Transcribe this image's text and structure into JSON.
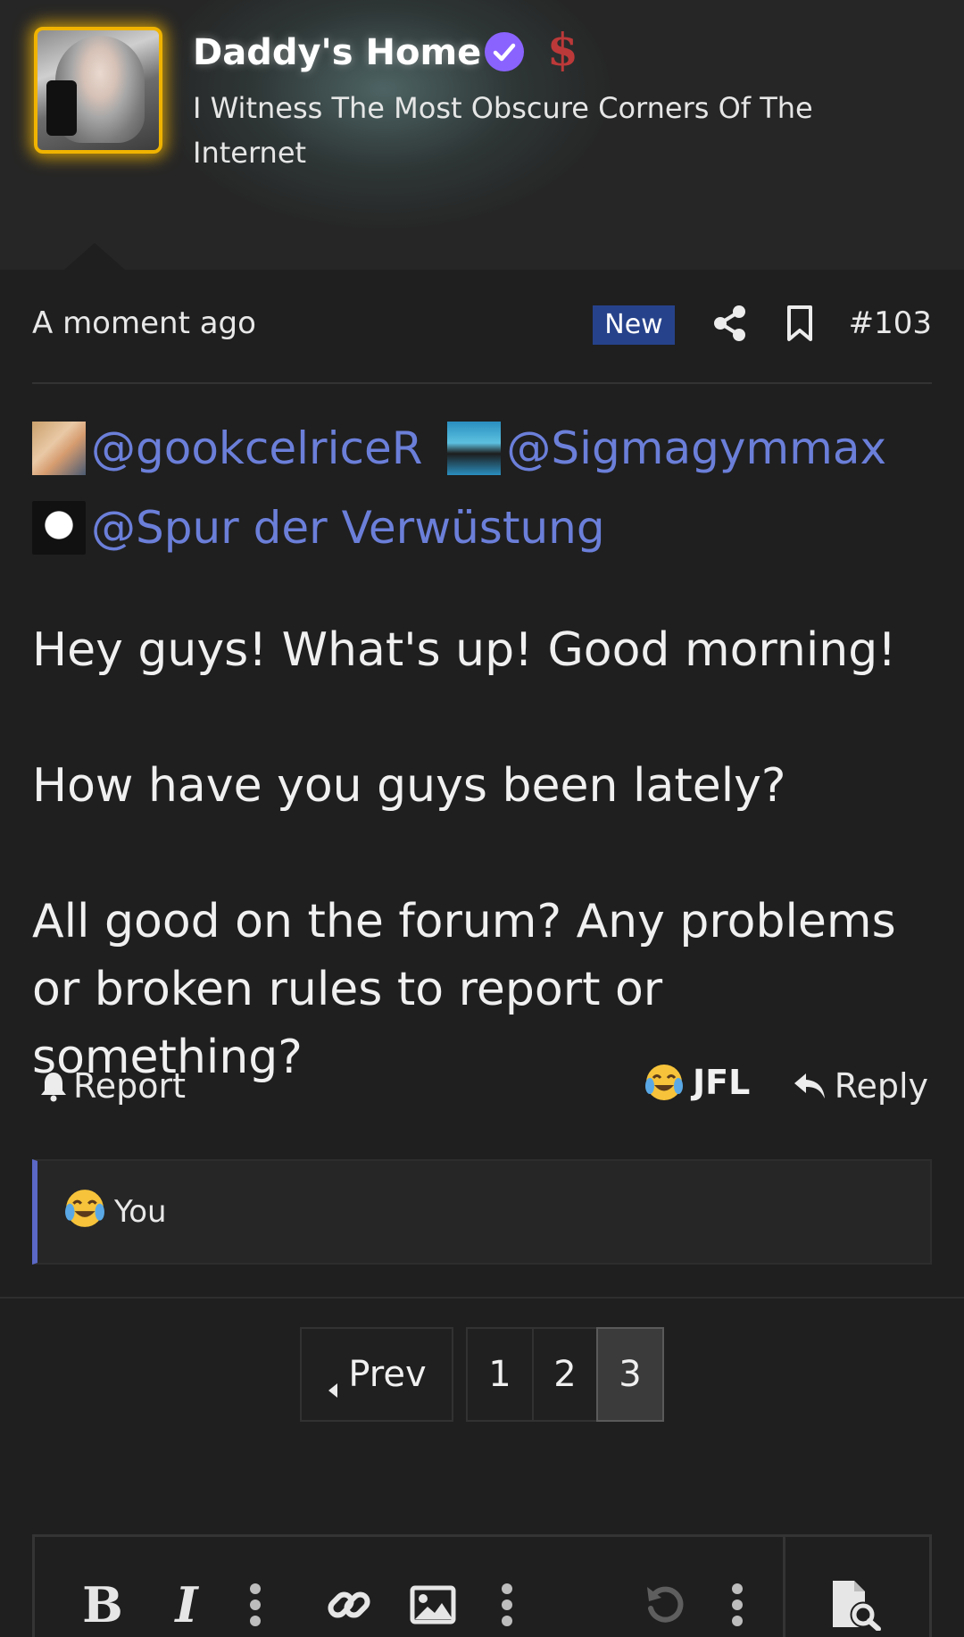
{
  "author": {
    "name": "Daddy's Home",
    "subtitle": "I Witness The Most Obscure Corners Of The Internet",
    "verified_icon": "verified-check-icon",
    "dollar_icon": "$",
    "avatar_glow_color": "#f0b400"
  },
  "post": {
    "time": "A moment ago",
    "new_badge": "New",
    "number": "#103",
    "mentions": [
      {
        "name": "@gookcelriceR"
      },
      {
        "name": "@Sigmagymmax"
      },
      {
        "name": "@Spur der Verwüstung"
      }
    ],
    "paragraphs": [
      "Hey guys! What's up! Good morning!",
      "How have you guys been lately?",
      "All good on the forum? Any problems or broken rules to report or something?"
    ]
  },
  "actions": {
    "report_label": "Report",
    "reaction_label": "JFL",
    "reply_label": "Reply"
  },
  "reactions_summary": {
    "text": "You"
  },
  "pagination": {
    "prev_label": "Prev",
    "pages": [
      "1",
      "2",
      "3"
    ],
    "current_page": "3"
  },
  "editor": {
    "bold_label": "B",
    "italic_label": "I"
  },
  "colors": {
    "background": "#1f1f1f",
    "mention": "#6b7fd9",
    "new_badge": "#26428b",
    "reaction_bar_accent": "#5b68c5",
    "verified": "#8a63ff"
  }
}
